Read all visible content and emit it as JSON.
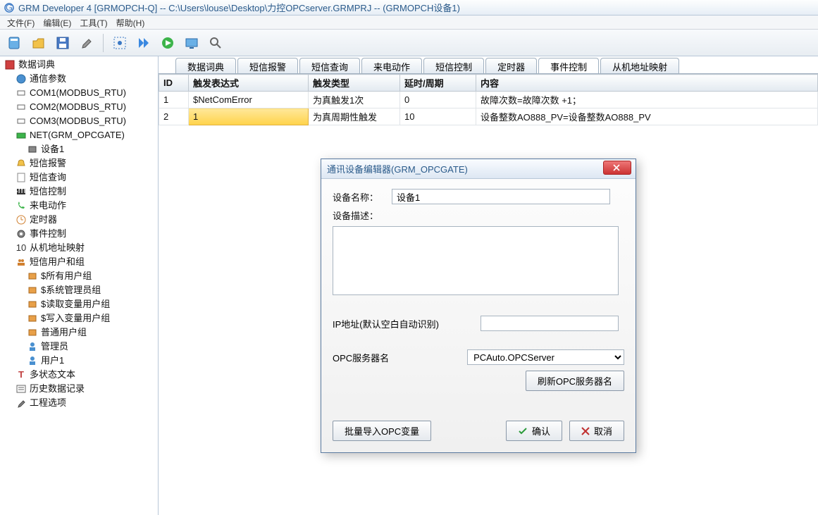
{
  "window": {
    "title": "GRM Developer 4 [GRMOPCH-Q]  -- C:\\Users\\louse\\Desktop\\力控OPCserver.GRMPRJ -- (GRMOPCH设备1)"
  },
  "menu": {
    "file": "文件(F)",
    "edit": "编辑(E)",
    "tool": "工具(T)",
    "help": "帮助(H)"
  },
  "tree": {
    "n0": "数据词典",
    "n1": "通信参数",
    "n2": "COM1(MODBUS_RTU)",
    "n3": "COM2(MODBUS_RTU)",
    "n4": "COM3(MODBUS_RTU)",
    "n5": "NET(GRM_OPCGATE)",
    "n6": "设备1",
    "n7": "短信报警",
    "n8": "短信查询",
    "n9": "短信控制",
    "n10": "来电动作",
    "n11": "定时器",
    "n12": "事件控制",
    "n13": "从机地址映射",
    "n14": "短信用户和组",
    "n15": "$所有用户组",
    "n16": "$系统管理员组",
    "n17": "$读取变量用户组",
    "n18": "$写入变量用户组",
    "n19": "普通用户组",
    "n20": "管理员",
    "n21": "用户1",
    "n22": "多状态文本",
    "n23": "历史数据记录",
    "n24": "工程选项"
  },
  "tabs": {
    "t0": "数据词典",
    "t1": "短信报警",
    "t2": "短信查询",
    "t3": "来电动作",
    "t4": "短信控制",
    "t5": "定时器",
    "t6": "事件控制",
    "t7": "从机地址映射"
  },
  "grid": {
    "h0": "ID",
    "h1": "触发表达式",
    "h2": "触发类型",
    "h3": "延时/周期",
    "h4": "内容",
    "r0c0": "1",
    "r0c1": "$NetComError",
    "r0c2": "为真触发1次",
    "r0c3": "0",
    "r0c4": "故障次数=故障次数 +1；",
    "r1c0": "2",
    "r1c1": "1",
    "r1c2": "为真周期性触发",
    "r1c3": "10",
    "r1c4": "设备整数AO888_PV=设备整数AO888_PV"
  },
  "dialog": {
    "title": "通讯设备编辑器(GRM_OPCGATE)",
    "lbl_name": "设备名称：",
    "val_name": "设备1",
    "lbl_desc": "设备描述：",
    "lbl_ip": "IP地址(默认空白自动识别)",
    "lbl_opc": "OPC服务器名",
    "val_opc": "PCAuto.OPCServer",
    "btn_refresh": "刷新OPC服务器名",
    "btn_import": "批量导入OPC变量",
    "btn_ok": "确认",
    "btn_cancel": "取消"
  }
}
